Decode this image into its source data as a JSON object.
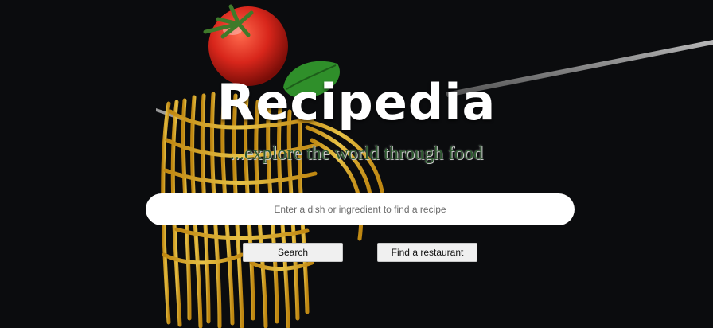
{
  "header": {
    "title": "Recipedia",
    "tagline": "...explore the world through food"
  },
  "search": {
    "placeholder": "Enter a dish or ingredient to find a recipe",
    "value": ""
  },
  "actions": {
    "search_label": "Search",
    "restaurant_label": "Find a restaurant"
  },
  "colors": {
    "background": "#0b0c0e",
    "title": "#ffffff",
    "tagline": "#2f5a31",
    "pasta": "#e8b830",
    "tomato": "#d8261b",
    "basil": "#2f8f2a"
  },
  "background_image": {
    "subject": "spaghetti twirled on a fork topped with a cherry tomato and basil leaf",
    "icon": "pasta-fork-photo"
  }
}
